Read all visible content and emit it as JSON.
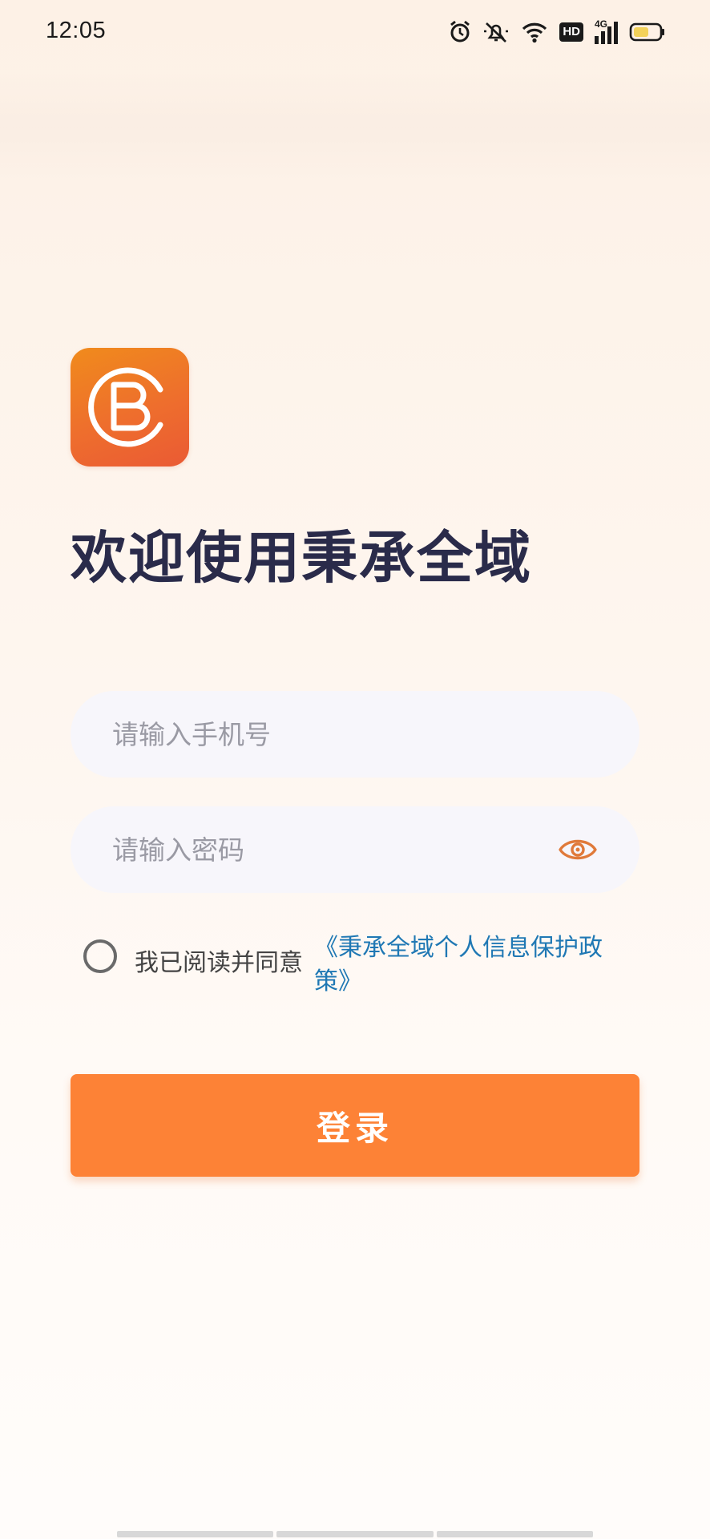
{
  "status_bar": {
    "time": "12:05",
    "icons": [
      "alarm-icon",
      "silent-icon",
      "wifi-icon",
      "hd-icon",
      "signal-4g-icon",
      "battery-icon"
    ],
    "hd_label": "HD",
    "network_label": "4G"
  },
  "app": {
    "logo_icon": "cb-logo-icon",
    "welcome_title": "欢迎使用秉承全域"
  },
  "form": {
    "phone_placeholder": "请输入手机号",
    "phone_value": "",
    "password_placeholder": "请输入密码",
    "password_value": "",
    "password_toggle_icon": "eye-icon",
    "agreement_checked": false,
    "agreement_text": "我已阅读并同意",
    "policy_link": "《秉承全域个人信息保护政策》",
    "login_label": "登录"
  },
  "colors": {
    "accent": "#fd8236",
    "logo_start": "#f08b1c",
    "logo_end": "#ea5a34",
    "link": "#1f78b4",
    "title": "#2a2b4a",
    "eye": "#e07a3a"
  }
}
